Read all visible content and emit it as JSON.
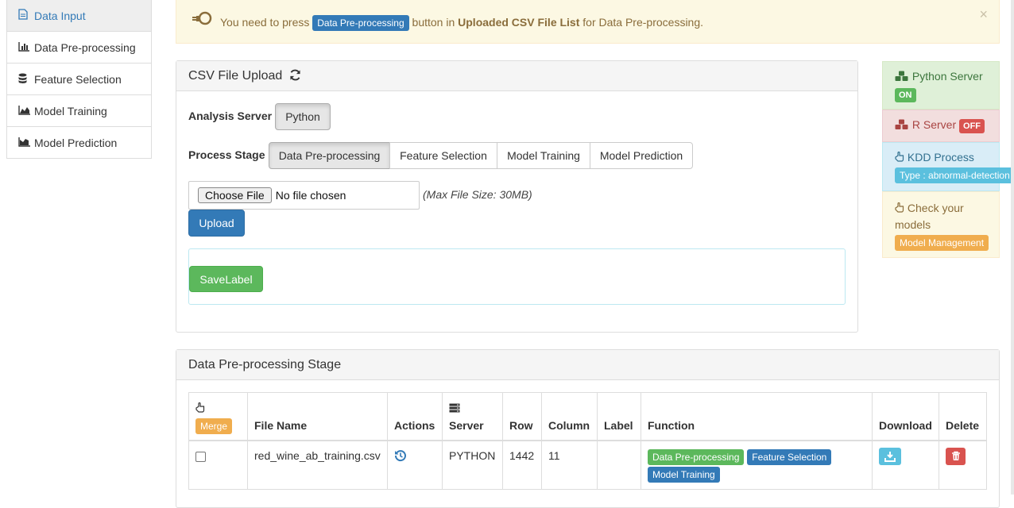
{
  "sidebar": {
    "items": [
      {
        "label": "Data Input",
        "icon": "file-icon"
      },
      {
        "label": "Data Pre-processing",
        "icon": "bar-chart-icon"
      },
      {
        "label": "Feature Selection",
        "icon": "database-icon"
      },
      {
        "label": "Model Training",
        "icon": "area-chart-icon"
      },
      {
        "label": "Model Prediction",
        "icon": "area-chart-icon"
      }
    ]
  },
  "alert": {
    "text_before": "You need to press",
    "badge": "Data Pre-processing",
    "text_mid": "button in",
    "bold": "Uploaded CSV File List",
    "text_after": "for Data Pre-processing.",
    "close": "×"
  },
  "upload_panel": {
    "title": "CSV File Upload",
    "analysis_server_label": "Analysis Server",
    "analysis_server_value": "Python",
    "process_stage_label": "Process Stage",
    "stages": [
      "Data Pre-processing",
      "Feature Selection",
      "Model Training",
      "Model Prediction"
    ],
    "choose_file": "Choose File",
    "no_file": "No file chosen",
    "max_size": "(Max File Size: 30MB)",
    "upload": "Upload",
    "save_label": "SaveLabel"
  },
  "status": {
    "python_server": "Python Server",
    "python_state": "ON",
    "r_server": "R Server",
    "r_state": "OFF",
    "kdd_process": "KDD Process",
    "kdd_type": "Type : abnormal-detection",
    "check_models_1": "Check your",
    "check_models_2": "models",
    "model_management": "Model Management"
  },
  "stage_panel": {
    "title": "Data Pre-processing Stage",
    "merge": "Merge",
    "columns": [
      "File Name",
      "Actions",
      "Server",
      "Row",
      "Column",
      "Label",
      "Function",
      "Download",
      "Delete"
    ],
    "rows": [
      {
        "file_name": "red_wine_ab_training.csv",
        "server": "PYTHON",
        "row": "1442",
        "column": "11",
        "label": "",
        "functions": [
          "Data Pre-processing",
          "Feature Selection",
          "Model Training"
        ]
      }
    ]
  },
  "colors": {
    "primary": "#337ab7",
    "success": "#5cb85c",
    "danger": "#d9534f",
    "info": "#5bc0de",
    "warning": "#f0ad4e"
  }
}
